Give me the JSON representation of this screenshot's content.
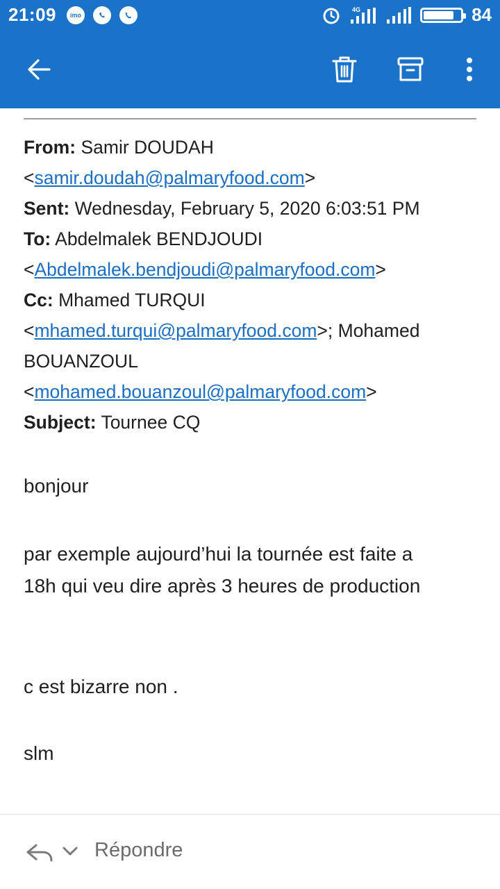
{
  "status_bar": {
    "time": "21:09",
    "notification_icons": [
      "imo-icon",
      "whatsapp-icon",
      "viber-icon"
    ],
    "network_label": "4G",
    "battery_percent": 84
  },
  "toolbar": {
    "back_icon": "arrow-left-icon",
    "delete_icon": "trash-icon",
    "archive_icon": "archive-icon",
    "more_icon": "more-vert-icon"
  },
  "email": {
    "from_label": "From:",
    "from_name": "Samir DOUDAH",
    "from_email": "samir.doudah@palmaryfood.com",
    "sent_label": "Sent:",
    "sent_value": "Wednesday, February 5, 2020 6:03:51 PM",
    "to_label": "To:",
    "to_name": "Abdelmalek BENDJOUDI",
    "to_email": "Abdelmalek.bendjoudi@palmaryfood.com",
    "cc_label": "Cc:",
    "cc1_name": "Mhamed TURQUI",
    "cc1_email": "mhamed.turqui@palmaryfood.com",
    "cc2_name_part1": "Mohamed",
    "cc2_name_part2": "BOUANZOUL",
    "cc2_email": "mohamed.bouanzoul@palmaryfood.com",
    "subject_label": "Subject:",
    "subject_value": "Tournee CQ",
    "body": {
      "greeting": "bonjour",
      "paragraph_line1": "par exemple aujourd’hui la tournée est faite a",
      "paragraph_line2": "18h qui veu dire après 3 heures de production",
      "question": "c est bizarre non .",
      "signoff": "slm"
    }
  },
  "reply_bar": {
    "reply_label": "Répondre"
  },
  "colors": {
    "accent": "#1a73c9",
    "link": "#1a6fc4"
  }
}
